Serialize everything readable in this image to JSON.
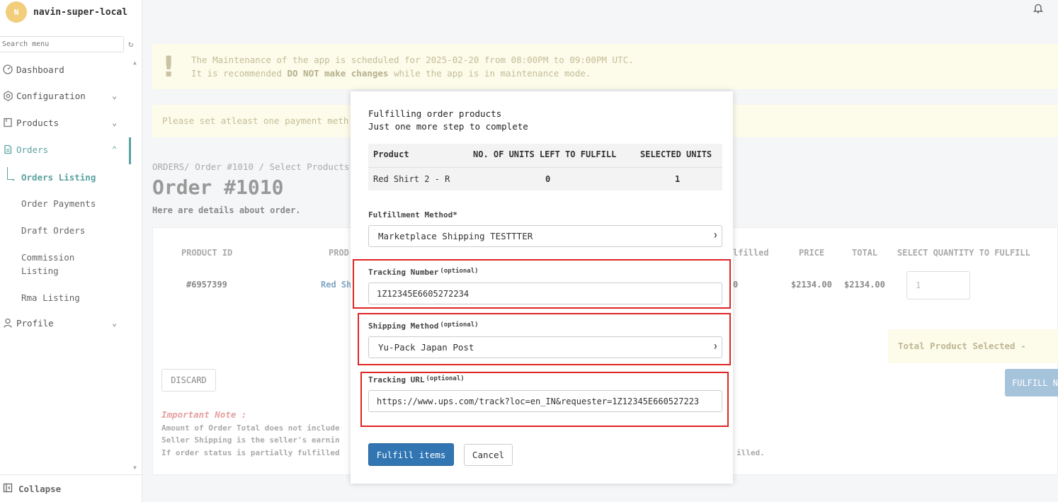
{
  "app": {
    "store_name": "navin-super-local",
    "avatar_letter": "N"
  },
  "sidebar": {
    "search_placeholder": "Search menu",
    "items": [
      {
        "label": "Dashboard"
      },
      {
        "label": "Configuration"
      },
      {
        "label": "Products"
      },
      {
        "label": "Orders"
      },
      {
        "label": "Profile"
      }
    ],
    "orders_sub": [
      {
        "label": "Orders Listing"
      },
      {
        "label": "Order Payments"
      },
      {
        "label": "Draft Orders"
      },
      {
        "label": "Commission"
      },
      {
        "label": "Listing"
      },
      {
        "label": "Rma Listing"
      }
    ],
    "collapse_label": "Collapse"
  },
  "banners": {
    "maintenance_line1": "The Maintenance of the app is scheduled for 2025-02-20 from 08:00PM to 09:00PM UTC.",
    "maintenance_line2_pre": "It is recommended ",
    "maintenance_line2_bold": "DO NOT make changes",
    "maintenance_line2_post": " while the app is in maintenance mode.",
    "payment": "Please set atleast one payment meth"
  },
  "page": {
    "breadcrumb": "ORDERS/ Order #1010 / Select Products",
    "title": "Order #1010",
    "subtitle": "Here are details about order."
  },
  "order_table": {
    "headers": [
      "PRODUCT ID",
      "PROD",
      "lfilled",
      "PRICE",
      "TOTAL",
      "SELECT QUANTITY TO FULFILL"
    ],
    "row": {
      "product_id": "#6957399",
      "product": "Red Sh",
      "fulfilled": "0",
      "price": "$2134.00",
      "total": "$2134.00",
      "qty": "1"
    },
    "total_selected": "Total Product Selected -",
    "fulfill_button": "FULFILL N",
    "discard_button": "DISCARD"
  },
  "notes": {
    "title": "Important Note :",
    "line1": "Amount of Order Total does not include",
    "line2": "Seller Shipping is the seller's earnin",
    "line3": "If order status is partially fulfilled",
    "line3_tail": "illed."
  },
  "modal": {
    "heading1": "Fulfilling order products",
    "heading2": "Just one more step to complete",
    "table_headers": [
      "Product",
      "NO. OF UNITS LEFT TO FULFILL",
      "SELECTED UNITS"
    ],
    "table_row": {
      "product": "Red Shirt 2 - R",
      "units_left": "0",
      "selected": "1"
    },
    "fulfillment_label": "Fulfillment Method*",
    "fulfillment_value": "Marketplace Shipping TESTTTER",
    "tracking_number_label": "Tracking Number",
    "tracking_number_value": "1Z12345E6605272234",
    "shipping_method_label": "Shipping Method",
    "shipping_method_value": "Yu-Pack Japan Post",
    "tracking_url_label": "Tracking URL",
    "tracking_url_value": "https://www.ups.com/track?loc=en_IN&requester=1Z12345E660527223",
    "optional": "(optional)",
    "fulfill_button": "Fulfill items",
    "cancel_button": "Cancel"
  },
  "colors": {
    "accent": "#5aa2a0",
    "primary_button": "#3175b3",
    "highlight": "#e02424",
    "banner_bg": "#fdfbe9"
  }
}
